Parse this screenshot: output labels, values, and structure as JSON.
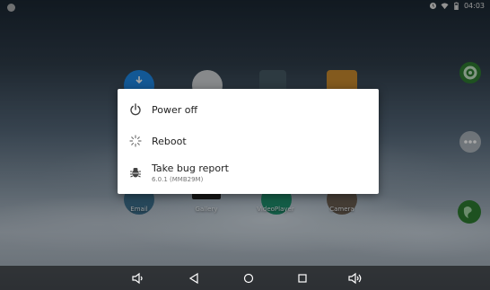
{
  "status_bar": {
    "time": "04:03",
    "icons": [
      "settings-dot-icon",
      "alarm-icon",
      "wifi-icon",
      "battery-icon"
    ]
  },
  "launcher": {
    "apps": [
      {
        "name": "Email"
      },
      {
        "name": "Gallery"
      },
      {
        "name": "VideoPlayer"
      },
      {
        "name": "Camera"
      }
    ]
  },
  "power_menu": {
    "items": [
      {
        "label": "Power off",
        "icon": "power-icon"
      },
      {
        "label": "Reboot",
        "icon": "reboot-spinner-icon"
      },
      {
        "label": "Take bug report",
        "sublabel": "6.0.1 (MMB29M)",
        "icon": "bug-icon"
      }
    ]
  },
  "nav_bar": {
    "buttons": [
      "volume-down-icon",
      "back-icon",
      "home-icon",
      "recents-icon",
      "volume-up-icon"
    ]
  },
  "colors": {
    "dialog_bg": "#ffffff",
    "text_primary": "#212121",
    "text_secondary": "#757575",
    "accent_green": "#4caf50"
  }
}
